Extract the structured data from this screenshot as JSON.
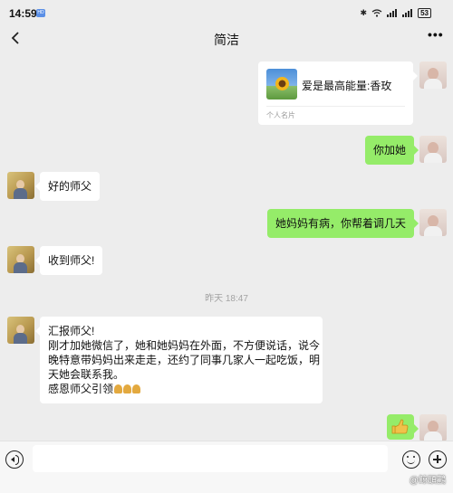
{
  "status_bar": {
    "time": "14:59",
    "app_indicator": "HD",
    "icons": [
      "bluetooth-icon",
      "wifi-icon",
      "signal-icon",
      "signal-icon"
    ],
    "battery": "53"
  },
  "header": {
    "title": "简洁",
    "back_icon": "chevron-left-icon",
    "more_icon": "more-dots-icon"
  },
  "messages": [
    {
      "from": "me",
      "type": "contact_card",
      "name": "爱是最高能量:香玫",
      "label": "个人名片"
    },
    {
      "from": "me",
      "type": "text",
      "lines": [
        "你加她"
      ]
    },
    {
      "from": "other",
      "type": "text",
      "lines": [
        "好的师父"
      ]
    },
    {
      "from": "me",
      "type": "text",
      "lines": [
        "她妈妈有病，你帮着调几天"
      ]
    },
    {
      "from": "other",
      "type": "text",
      "lines": [
        "收到师父!"
      ]
    },
    {
      "from": "system",
      "type": "timestamp",
      "text": "昨天 18:47"
    },
    {
      "from": "other",
      "type": "text",
      "lines": [
        "汇报师父!",
        "刚才加她微信了，她和她妈妈在外面，不方便说话，说今",
        "晚特意带妈妈出来走走，还约了同事几家人一起吃饭，明",
        "天她会联系我。",
        "感恩师父引领"
      ],
      "trailing_emoji": [
        "folded-hands-emoji",
        "folded-hands-emoji",
        "folded-hands-emoji"
      ]
    },
    {
      "from": "me",
      "type": "emoji",
      "emoji": "thumbs-up-emoji"
    }
  ],
  "input_bar": {
    "value": "",
    "placeholder": ""
  },
  "watermark": "@鲸頭鸛",
  "colors": {
    "background": "#ededed",
    "sent_bubble": "#95ec69",
    "received_bubble": "#ffffff"
  }
}
